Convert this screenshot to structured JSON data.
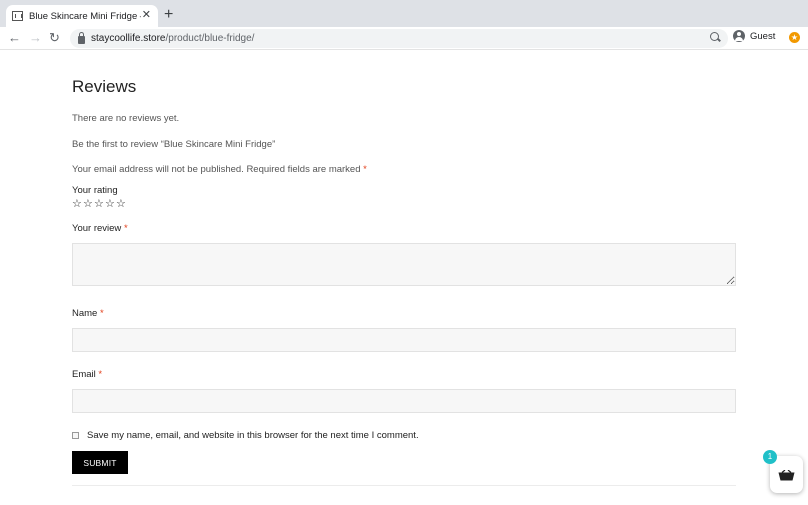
{
  "browser": {
    "tab_title": "Blue Skincare Mini Fridge – Sta",
    "tab_close": "✕",
    "new_tab": "+",
    "url_host": "staycoollife.store",
    "url_path": "/product/blue-fridge/",
    "profile_label": "Guest",
    "nav": {
      "back": "←",
      "forward": "→",
      "reload": "↻"
    }
  },
  "reviews": {
    "title": "Reviews",
    "no_reviews": "There are no reviews yet.",
    "be_first": "Be the first to review “Blue Skincare Mini Fridge”",
    "email_note": "Your email address will not be published. Required fields are marked",
    "required_marker": "*",
    "rating_label": "Your rating",
    "stars": [
      "☆",
      "☆",
      "☆",
      "☆",
      "☆"
    ],
    "review_label": "Your review",
    "name_label": "Name",
    "email_label": "Email",
    "consent_label": "Save my name, email, and website in this browser for the next time I comment.",
    "submit_label": "SUBMIT"
  },
  "cart": {
    "count": "1",
    "icon": "basket-icon"
  },
  "colors": {
    "required": "#e2401c",
    "badge": "#20c0c8",
    "submit_bg": "#000000"
  }
}
